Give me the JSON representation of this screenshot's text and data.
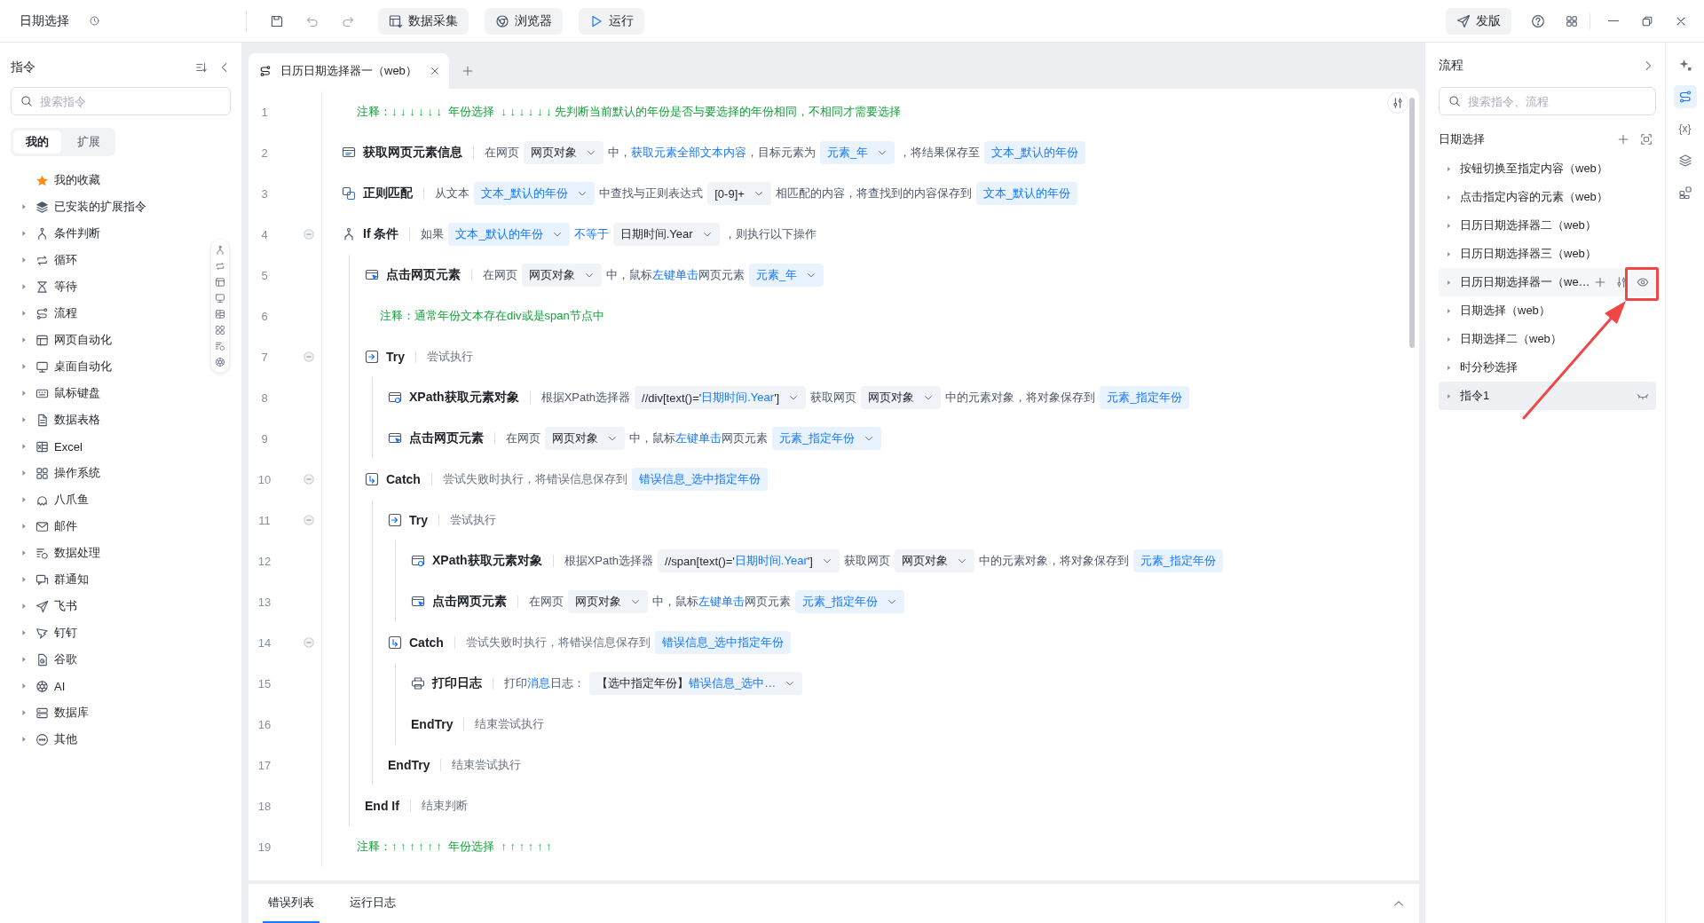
{
  "topbar": {
    "title": "日期选择",
    "buttons": [
      {
        "kind": "collect",
        "label": "数据采集"
      },
      {
        "kind": "browser",
        "label": "浏览器"
      },
      {
        "kind": "run",
        "label": "运行"
      }
    ],
    "publish": "发版"
  },
  "commands": {
    "title": "指令",
    "search": {
      "placeholder": "搜索指令"
    },
    "tabs": [
      {
        "label": "我的",
        "selected": true
      },
      {
        "label": "扩展",
        "selected": false
      }
    ],
    "items": [
      {
        "label": "我的收藏",
        "kind": "favorite"
      },
      {
        "label": "已安装的扩展指令",
        "kind": "group",
        "expanded": false
      },
      {
        "label": "条件判断",
        "kind": "group",
        "expanded": false
      },
      {
        "label": "循环",
        "kind": "group",
        "expanded": false
      },
      {
        "label": "等待",
        "kind": "group",
        "expanded": false
      },
      {
        "label": "流程",
        "kind": "group",
        "expanded": false
      },
      {
        "label": "网页自动化",
        "kind": "group",
        "expanded": false
      },
      {
        "label": "桌面自动化",
        "kind": "group",
        "expanded": false
      },
      {
        "label": "鼠标键盘",
        "kind": "group",
        "expanded": false
      },
      {
        "label": "数据表格",
        "kind": "group",
        "expanded": false
      },
      {
        "label": "Excel",
        "kind": "group",
        "expanded": false
      },
      {
        "label": "操作系统",
        "kind": "group",
        "expanded": false
      },
      {
        "label": "八爪鱼",
        "kind": "group",
        "expanded": false
      },
      {
        "label": "邮件",
        "kind": "group",
        "expanded": false
      },
      {
        "label": "数据处理",
        "kind": "group",
        "expanded": false
      },
      {
        "label": "群通知",
        "kind": "group",
        "expanded": false
      },
      {
        "label": "飞书",
        "kind": "group",
        "expanded": false
      },
      {
        "label": "钉钉",
        "kind": "group",
        "expanded": false
      },
      {
        "label": "谷歌",
        "kind": "group",
        "expanded": false
      },
      {
        "label": "AI",
        "kind": "group",
        "expanded": false
      },
      {
        "label": "数据库",
        "kind": "group",
        "expanded": false
      },
      {
        "label": "其他",
        "kind": "group",
        "expanded": false
      }
    ]
  },
  "editor": {
    "tabs": [
      {
        "label": "日历日期选择器一（web）",
        "selected": true
      }
    ],
    "steps": [
      {
        "number": "1",
        "kind": "comment",
        "text": "注释：↓ ↓ ↓ ↓ ↓ ↓  年份选择  ↓ ↓ ↓ ↓ ↓ ↓ 先判断当前默认的年份是否与要选择的年份相同，不相同才需要选择"
      },
      {
        "number": "2",
        "kind": "get-info",
        "title": "获取网页元素信息",
        "parts": [
          {
            "kind": "text",
            "text": "在网页"
          },
          {
            "kind": "value-chip",
            "text": "网页对象",
            "dropdown": true
          },
          {
            "kind": "text",
            "text": "中，"
          },
          {
            "kind": "link",
            "text": "获取元素全部文本内容"
          },
          {
            "kind": "text",
            "text": "，目标元素为"
          },
          {
            "kind": "var-chip",
            "text": "元素_年",
            "dropdown": true
          },
          {
            "kind": "text",
            "text": "，将结果保存至"
          },
          {
            "kind": "var-chip",
            "text": "文本_默认的年份",
            "dropdown": false
          }
        ]
      },
      {
        "number": "3",
        "kind": "regex",
        "title": "正则匹配",
        "parts": [
          {
            "kind": "text",
            "text": "从文本"
          },
          {
            "kind": "var-chip",
            "text": "文本_默认的年份",
            "dropdown": true
          },
          {
            "kind": "text",
            "text": "中查找与正则表达式"
          },
          {
            "kind": "value-chip",
            "text": "[0-9]+",
            "dropdown": true
          },
          {
            "kind": "text",
            "text": "相匹配的内容，将查找到的内容保存到"
          },
          {
            "kind": "var-chip",
            "text": "文本_默认的年份",
            "dropdown": false
          }
        ]
      },
      {
        "number": "4",
        "kind": "if",
        "title": "If 条件",
        "expanded": true,
        "parts": [
          {
            "kind": "text",
            "text": "如果"
          },
          {
            "kind": "var-chip",
            "text": "文本_默认的年份",
            "dropdown": true
          },
          {
            "kind": "link",
            "text": "不等于"
          },
          {
            "kind": "value-chip",
            "text": "日期时间.Year",
            "dropdown": true
          },
          {
            "kind": "text",
            "text": "，则执行以下操作"
          }
        ],
        "children": [
          {
            "number": "5",
            "kind": "click",
            "title": "点击网页元素",
            "parts": [
              {
                "kind": "text",
                "text": "在网页"
              },
              {
                "kind": "value-chip",
                "text": "网页对象",
                "dropdown": true
              },
              {
                "kind": "text",
                "text": "中，鼠标"
              },
              {
                "kind": "link",
                "text": "左键单击"
              },
              {
                "kind": "text",
                "text": "网页元素"
              },
              {
                "kind": "var-chip",
                "text": "元素_年",
                "dropdown": true
              }
            ]
          },
          {
            "number": "6",
            "kind": "comment",
            "text": "注释：通常年份文本存在div或是span节点中"
          },
          {
            "number": "7",
            "kind": "try",
            "title": "Try",
            "expanded": true,
            "parts": [
              {
                "kind": "note",
                "text": "尝试执行"
              }
            ],
            "children": [
              {
                "number": "8",
                "kind": "xpath",
                "title": "XPath获取元素对象",
                "parts": [
                  {
                    "kind": "text",
                    "text": "根据XPath选择器"
                  },
                  {
                    "kind": "value-chip",
                    "segments": [
                      {
                        "kind": "text",
                        "text": "//div[text()='"
                      },
                      {
                        "kind": "link",
                        "text": "日期时间.Year"
                      },
                      {
                        "kind": "text",
                        "text": "']"
                      }
                    ],
                    "dropdown": true
                  },
                  {
                    "kind": "text",
                    "text": "获取网页"
                  },
                  {
                    "kind": "value-chip",
                    "text": "网页对象",
                    "dropdown": true
                  },
                  {
                    "kind": "text",
                    "text": "中的元素对象，将对象保存到"
                  },
                  {
                    "kind": "var-chip",
                    "text": "元素_指定年份",
                    "dropdown": false
                  }
                ]
              },
              {
                "number": "9",
                "kind": "click",
                "title": "点击网页元素",
                "parts": [
                  {
                    "kind": "text",
                    "text": "在网页"
                  },
                  {
                    "kind": "value-chip",
                    "text": "网页对象",
                    "dropdown": true
                  },
                  {
                    "kind": "text",
                    "text": "中，鼠标"
                  },
                  {
                    "kind": "link",
                    "text": "左键单击"
                  },
                  {
                    "kind": "text",
                    "text": "网页元素"
                  },
                  {
                    "kind": "var-chip",
                    "text": "元素_指定年份",
                    "dropdown": true
                  }
                ]
              }
            ]
          },
          {
            "number": "10",
            "kind": "catch",
            "title": "Catch",
            "expanded": true,
            "parts": [
              {
                "kind": "note",
                "text": "尝试失败时执行，将错误信息保存到"
              },
              {
                "kind": "var-chip",
                "text": "错误信息_选中指定年份",
                "dropdown": false
              }
            ],
            "children": [
              {
                "number": "11",
                "kind": "try",
                "title": "Try",
                "expanded": true,
                "parts": [
                  {
                    "kind": "note",
                    "text": "尝试执行"
                  }
                ],
                "children": [
                  {
                    "number": "12",
                    "kind": "xpath",
                    "title": "XPath获取元素对象",
                    "parts": [
                      {
                        "kind": "text",
                        "text": "根据XPath选择器"
                      },
                      {
                        "kind": "value-chip",
                        "segments": [
                          {
                            "kind": "text",
                            "text": "//span[text()='"
                          },
                          {
                            "kind": "link",
                            "text": "日期时间.Year"
                          },
                          {
                            "kind": "text",
                            "text": "']"
                          }
                        ],
                        "dropdown": true
                      },
                      {
                        "kind": "text",
                        "text": "获取网页"
                      },
                      {
                        "kind": "value-chip",
                        "text": "网页对象",
                        "dropdown": true
                      },
                      {
                        "kind": "text",
                        "text": "中的元素对象，将对象保存到"
                      },
                      {
                        "kind": "var-chip",
                        "text": "元素_指定年份",
                        "dropdown": false
                      }
                    ]
                  },
                  {
                    "number": "13",
                    "kind": "click",
                    "title": "点击网页元素",
                    "parts": [
                      {
                        "kind": "text",
                        "text": "在网页"
                      },
                      {
                        "kind": "value-chip",
                        "text": "网页对象",
                        "dropdown": true
                      },
                      {
                        "kind": "text",
                        "text": "中，鼠标"
                      },
                      {
                        "kind": "link",
                        "text": "左键单击"
                      },
                      {
                        "kind": "text",
                        "text": "网页元素"
                      },
                      {
                        "kind": "var-chip",
                        "text": "元素_指定年份",
                        "dropdown": true
                      }
                    ]
                  }
                ]
              },
              {
                "number": "14",
                "kind": "catch",
                "title": "Catch",
                "expanded": true,
                "parts": [
                  {
                    "kind": "note",
                    "text": "尝试失败时执行，将错误信息保存到"
                  },
                  {
                    "kind": "var-chip",
                    "text": "错误信息_选中指定年份",
                    "dropdown": false
                  }
                ],
                "children": [
                  {
                    "number": "15",
                    "kind": "log",
                    "title": "打印日志",
                    "parts": [
                      {
                        "kind": "text",
                        "text": "打印"
                      },
                      {
                        "kind": "link",
                        "text": "消息"
                      },
                      {
                        "kind": "text",
                        "text": "日志："
                      },
                      {
                        "kind": "value-chip",
                        "segments": [
                          {
                            "kind": "text",
                            "text": "【选中指定年份】"
                          },
                          {
                            "kind": "link",
                            "text": "错误信息_选中…"
                          }
                        ],
                        "dropdown": true
                      }
                    ]
                  },
                  {
                    "number": "16",
                    "kind": "end",
                    "title": "EndTry",
                    "parts": [
                      {
                        "kind": "note",
                        "text": "结束尝试执行"
                      }
                    ]
                  }
                ]
              },
              {
                "number": "17",
                "kind": "end",
                "title": "EndTry",
                "parts": [
                  {
                    "kind": "note",
                    "text": "结束尝试执行"
                  }
                ]
              }
            ]
          },
          {
            "number": "18",
            "kind": "end",
            "title": "End If",
            "parts": [
              {
                "kind": "note",
                "text": "结束判断"
              }
            ]
          }
        ]
      },
      {
        "number": "19",
        "kind": "comment",
        "text": "注释：↑ ↑ ↑ ↑ ↑ ↑  年份选择  ↑ ↑ ↑ ↑ ↑ ↑"
      }
    ]
  },
  "bottom_panel": {
    "tabs": [
      {
        "label": "错误列表",
        "selected": true
      },
      {
        "label": "运行日志",
        "selected": false
      }
    ]
  },
  "flows": {
    "title": "流程",
    "search": {
      "placeholder": "搜索指令、流程"
    },
    "group": "日期选择",
    "items": [
      {
        "label": "按钮切换至指定内容（web）",
        "expanded": false,
        "hovered": false,
        "selected": false,
        "hidden": false
      },
      {
        "label": "点击指定内容的元素（web）",
        "expanded": false,
        "hovered": false,
        "selected": false,
        "hidden": false
      },
      {
        "label": "日历日期选择器二（web）",
        "expanded": false,
        "hovered": false,
        "selected": false,
        "hidden": false
      },
      {
        "label": "日历日期选择器三（web）",
        "expanded": false,
        "hovered": false,
        "selected": false,
        "hidden": false
      },
      {
        "label": "日历日期选择器一（we…",
        "expanded": false,
        "hovered": true,
        "selected": false,
        "hidden": false
      },
      {
        "label": "日期选择（web）",
        "expanded": false,
        "hovered": false,
        "selected": false,
        "hidden": false
      },
      {
        "label": "日期选择二（web）",
        "expanded": false,
        "hovered": false,
        "selected": false,
        "hidden": false
      },
      {
        "label": "时分秒选择",
        "expanded": false,
        "hovered": false,
        "selected": false,
        "hidden": false
      },
      {
        "label": "指令1",
        "expanded": false,
        "hovered": false,
        "selected": true,
        "hidden": true
      }
    ]
  },
  "rail": [
    {
      "selected": false
    },
    {
      "selected": true
    },
    {
      "glyph": "{x}",
      "selected": false
    },
    {
      "selected": false
    },
    {
      "selected": false
    }
  ]
}
